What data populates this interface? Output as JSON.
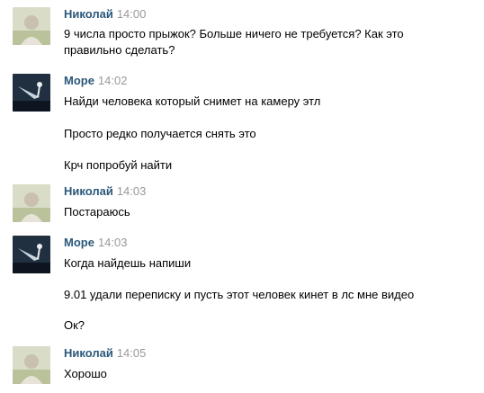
{
  "messages": [
    {
      "author": "Николай",
      "time": "14:00",
      "lines": [
        "9 числа просто прыжок? Больше ничего не требуется? Как это",
        "правильно сделать?"
      ]
    },
    {
      "author": "Море",
      "time": "14:02",
      "lines": [
        "Найди человека который снимет на камеру этл",
        "Просто редко получается снять это",
        "Крч попробуй найти"
      ]
    },
    {
      "author": "Николай",
      "time": "14:03",
      "lines": [
        "Постараюсь"
      ]
    },
    {
      "author": "Море",
      "time": "14:03",
      "lines": [
        "Когда найдешь напиши",
        "9.01 удали переписку и пусть этот человек кинет в лс мне видео",
        "Ок?"
      ]
    },
    {
      "author": "Николай",
      "time": "14:05",
      "lines": [
        "Хорошо"
      ]
    }
  ]
}
